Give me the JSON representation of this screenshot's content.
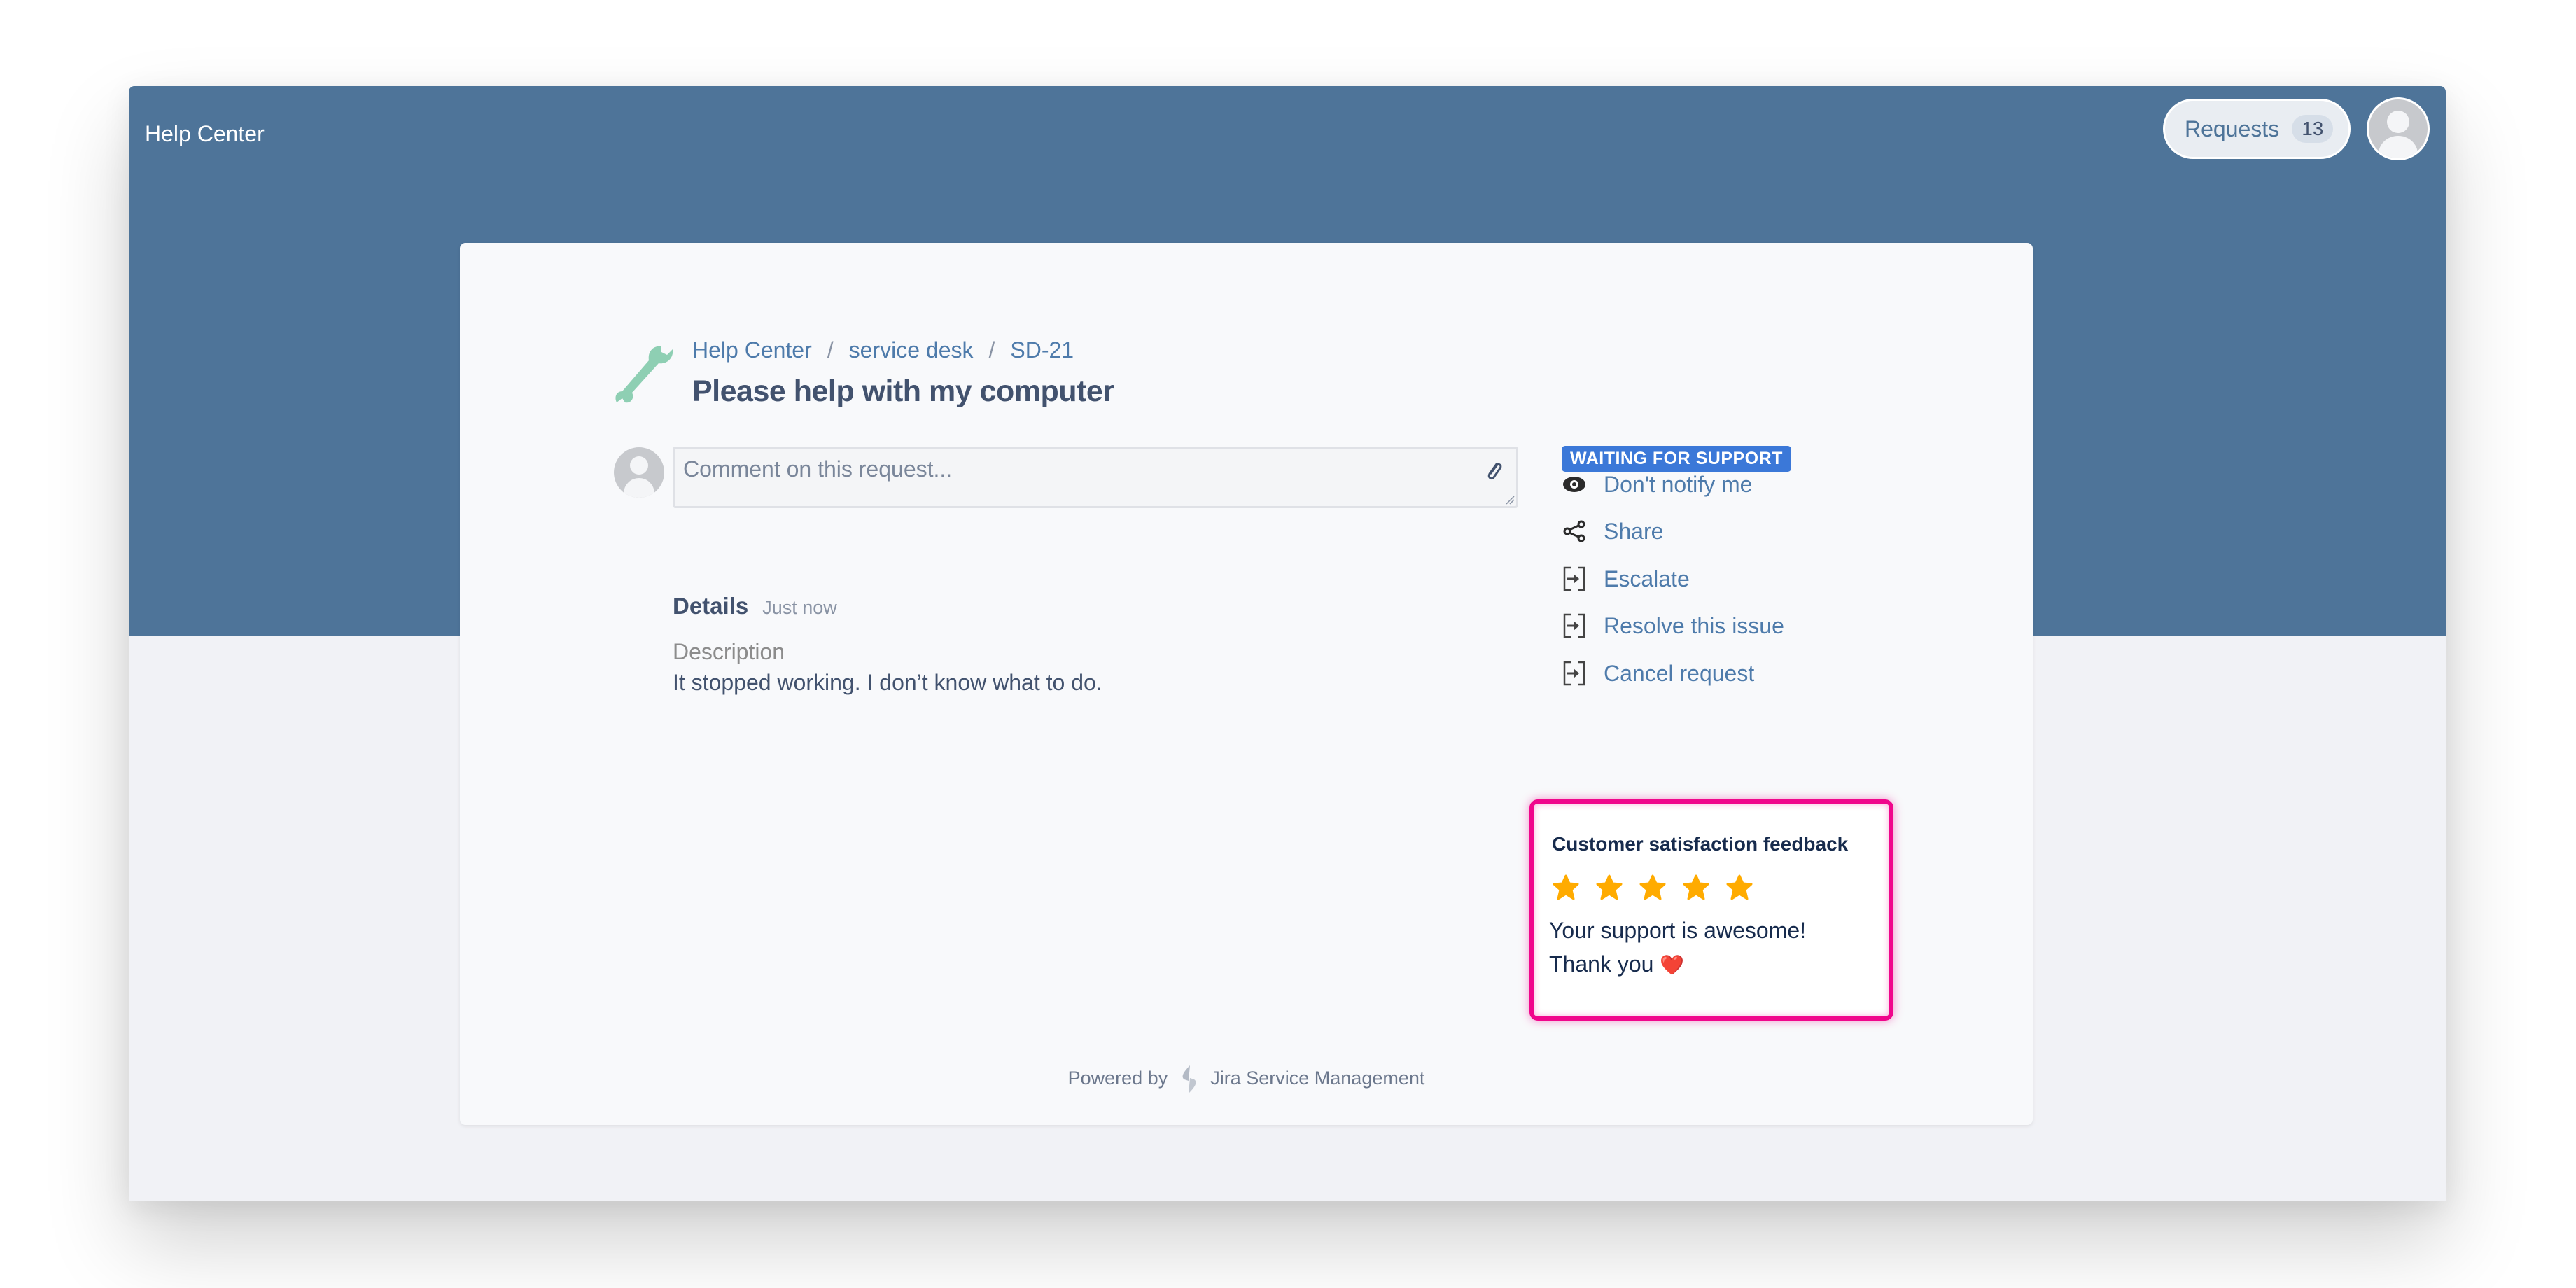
{
  "header": {
    "brand": "Help Center",
    "requests_label": "Requests",
    "requests_count": "13",
    "banner_color": "#4e7499"
  },
  "request": {
    "breadcrumb": [
      "Help Center",
      "service desk",
      "SD-21"
    ],
    "breadcrumb_separator": "/",
    "title": "Please help with my computer",
    "comment_placeholder": "Comment on this request...",
    "details_label": "Details",
    "details_time": "Just now",
    "description_label": "Description",
    "description_text": "It stopped working. I don’t know what to do."
  },
  "sidebar": {
    "status": "WAITING FOR SUPPORT",
    "status_color": "#3b78d8",
    "actions": [
      {
        "label": "Don't notify me",
        "icon": "eye-icon"
      },
      {
        "label": "Share",
        "icon": "share-icon"
      },
      {
        "label": "Escalate",
        "icon": "transition-icon"
      },
      {
        "label": "Resolve this issue",
        "icon": "transition-icon"
      },
      {
        "label": "Cancel request",
        "icon": "transition-icon"
      }
    ]
  },
  "feedback": {
    "title": "Customer satisfaction feedback",
    "rating": 5,
    "rating_max": 5,
    "line1": "Your support is awesome!",
    "line2": "Thank you",
    "emoji": "❤️",
    "highlight_color": "#f0068c",
    "star_color": "#ffab00"
  },
  "footer": {
    "powered_by": "Powered by",
    "product": "Jira Service Management"
  }
}
